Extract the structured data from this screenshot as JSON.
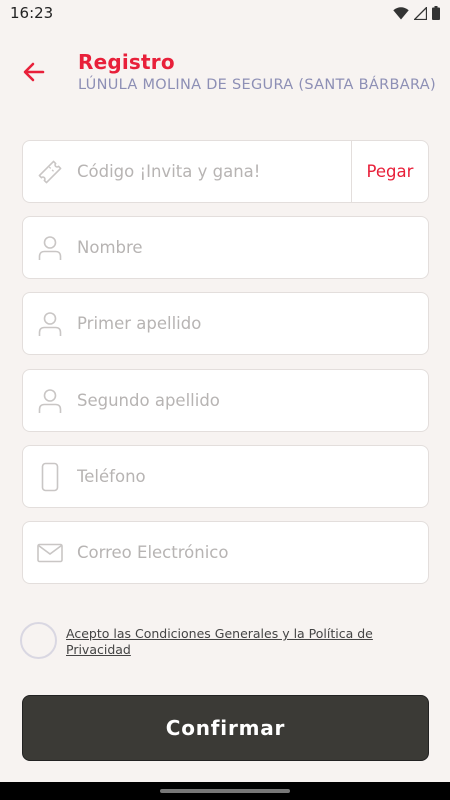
{
  "status_bar": {
    "time": "16:23"
  },
  "header": {
    "title": "Registro",
    "subtitle": "LÚNULA MOLINA DE SEGURA (SANTA BÁRBARA)"
  },
  "form": {
    "code": {
      "placeholder": "Código ¡Invita y gana!",
      "value": "",
      "paste_label": "Pegar"
    },
    "first_name": {
      "placeholder": "Nombre",
      "value": ""
    },
    "first_surname": {
      "placeholder": "Primer apellido",
      "value": ""
    },
    "second_surname": {
      "placeholder": "Segundo apellido",
      "value": ""
    },
    "phone": {
      "placeholder": "Teléfono",
      "value": ""
    },
    "email": {
      "placeholder": "Correo Electrónico",
      "value": ""
    }
  },
  "terms": {
    "checked": false,
    "label": "Acepto las Condiciones Generales y la Política de Privacidad"
  },
  "confirm_label": "Confirmar",
  "colors": {
    "accent": "#e8203a",
    "subtitle": "#8d8fb5",
    "background": "#f7f3f1",
    "button": "#3b3a36"
  },
  "icons": {
    "back": "arrow-left-icon",
    "code": "ticket-icon",
    "name": "person-icon",
    "phone": "phone-icon",
    "email": "envelope-icon"
  }
}
